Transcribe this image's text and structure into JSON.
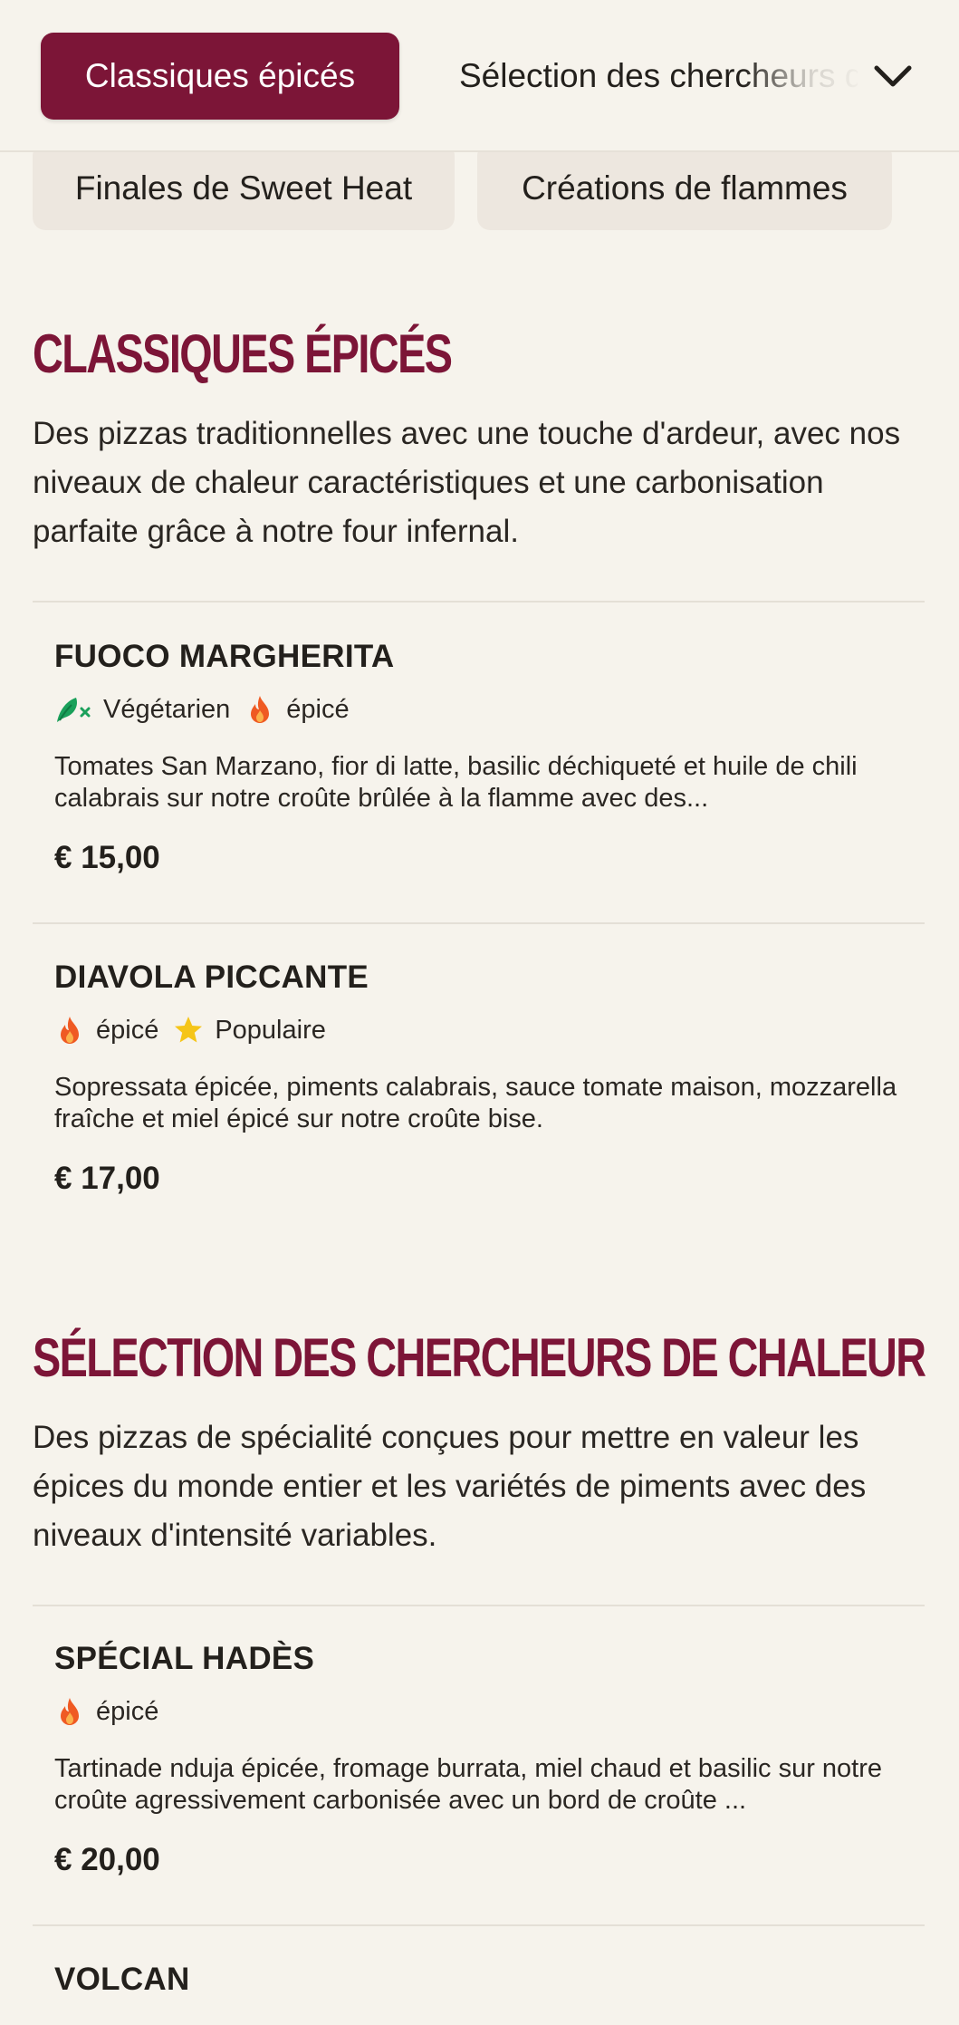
{
  "categories": {
    "active": "Classiques épicés",
    "next": "Sélection des chercheurs de chaleur",
    "row2": [
      "Finales de Sweet Heat",
      "Créations de flammes"
    ]
  },
  "sections": [
    {
      "title": "Classiques épicés",
      "description": "Des pizzas traditionnelles avec une touche d'ardeur, avec nos niveaux de chaleur caractéristiques et une carbonisation parfaite grâce à notre four infernal.",
      "items": [
        {
          "name": "FUOCO MARGHERITA",
          "tags": [
            {
              "icon": "vegetarian-leaf-icon",
              "label": "Végétarien"
            },
            {
              "icon": "flame-icon",
              "label": "épicé"
            }
          ],
          "description": "Tomates San Marzano, fior di latte, basilic déchiqueté et huile de chili calabrais sur notre croûte brûlée à la flamme avec des...",
          "price": "€ 15,00"
        },
        {
          "name": "DIAVOLA PICCANTE",
          "tags": [
            {
              "icon": "flame-icon",
              "label": "épicé"
            },
            {
              "icon": "star-icon",
              "label": "Populaire"
            }
          ],
          "description": "Sopressata épicée, piments calabrais, sauce tomate maison, mozzarella fraîche et miel épicé sur notre croûte bise.",
          "price": "€ 17,00"
        }
      ]
    },
    {
      "title": "Sélection des chercheurs de chaleur",
      "description": "Des pizzas de spécialité conçues pour mettre en valeur les épices du monde entier et les variétés de piments avec des niveaux d'intensité variables.",
      "items": [
        {
          "name": "SPÉCIAL HADÈS",
          "tags": [
            {
              "icon": "flame-icon",
              "label": "épicé"
            }
          ],
          "description": "Tartinade nduja épicée, fromage burrata, miel chaud et basilic sur notre croûte agressivement carbonisée avec un bord de croûte ...",
          "price": "€ 20,00"
        },
        {
          "name": "VOLCAN",
          "tags": [],
          "description": "",
          "price": ""
        }
      ]
    }
  ],
  "colors": {
    "brand": "#7c1537",
    "background": "#f6f3ec",
    "flame": "#ef5a23",
    "star": "#f5c518",
    "leaf": "#1aa05a"
  }
}
